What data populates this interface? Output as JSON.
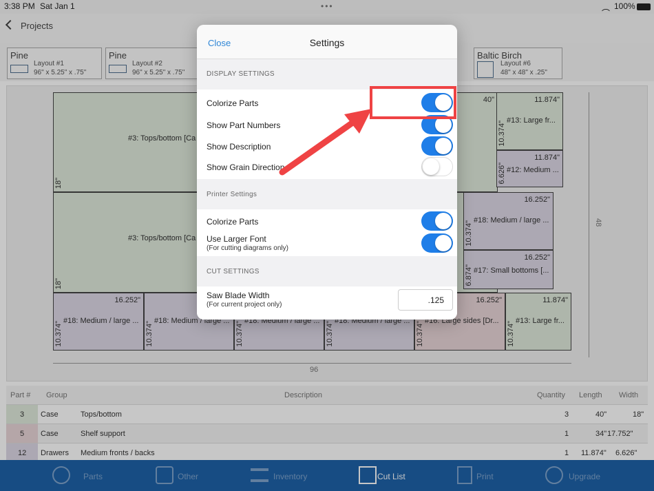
{
  "status": {
    "time": "3:38 PM",
    "date": "Sat Jan 1",
    "battery": "100%"
  },
  "nav": {
    "back_label": "Projects"
  },
  "chips": [
    {
      "material": "Pine",
      "name": "Layout #1",
      "dims": "96\" x 5.25\" x .75\""
    },
    {
      "material": "Pine",
      "name": "Layout #2",
      "dims": "96\" x 5.25\" x .75\""
    },
    {
      "material": "Baltic Birch",
      "name": "Layout #6",
      "dims": "48\" x 48\" x .25\""
    }
  ],
  "diagram": {
    "width_label": "96",
    "height_label": "48",
    "parts": [
      {
        "desc": "#3: Tops/bottom [Ca",
        "len": "",
        "wid": "18\""
      },
      {
        "desc": "#3: Tops/bottom [Ca",
        "len": "",
        "wid": "18\""
      },
      {
        "desc": "",
        "len": "40\"",
        "wid": ""
      },
      {
        "desc": "#13: Large fr...",
        "len": "11.874\"",
        "wid": "10.374\""
      },
      {
        "desc": "#12: Medium ...",
        "len": "11.874\"",
        "wid": "6.626\""
      },
      {
        "desc": "#18: Medium / large ...",
        "len": "16.252\"",
        "wid": "10.374\""
      },
      {
        "desc": "#17: Small bottoms [...",
        "len": "16.252\"",
        "wid": "6.874\""
      },
      {
        "desc": "#18: Medium / large ...",
        "len": "16.252\"",
        "wid": "10.374\""
      },
      {
        "desc": "#18: Medium / large ...",
        "len": "",
        "wid": "10.374\""
      },
      {
        "desc": "#18: Medium / large ...",
        "len": "",
        "wid": "10.374\""
      },
      {
        "desc": "#18: Medium / large ...",
        "len": "",
        "wid": "10.374\""
      },
      {
        "desc": "#16: Large sides [Dr...",
        "len": "16.252\"",
        "wid": "10.374\""
      },
      {
        "desc": "#13: Large fr...",
        "len": "11.874\"",
        "wid": "10.374\""
      }
    ]
  },
  "table": {
    "headers": [
      "Part #",
      "Group",
      "Description",
      "Quantity",
      "Length",
      "Width"
    ],
    "rows": [
      {
        "part": "3",
        "group": "Case",
        "desc": "Tops/bottom",
        "qty": "3",
        "len": "40\"",
        "wid": "18\"",
        "color": "#dfe9dc"
      },
      {
        "part": "5",
        "group": "Case",
        "desc": "Shelf support",
        "qty": "1",
        "len": "34\"",
        "wid": "17.752\"",
        "color": "#e8d5d8"
      },
      {
        "part": "12",
        "group": "Drawers",
        "desc": "Medium fronts / backs",
        "qty": "1",
        "len": "11.874\"",
        "wid": "6.626\"",
        "color": "#ddd8e6"
      }
    ]
  },
  "tabs": [
    {
      "label": "Parts",
      "icon": "tape-measure-icon"
    },
    {
      "label": "Other",
      "icon": "other-tools-icon"
    },
    {
      "label": "Inventory",
      "icon": "stack-icon"
    },
    {
      "label": "Cut List",
      "icon": "cut-list-icon",
      "active": true
    },
    {
      "label": "Print",
      "icon": "print-icon"
    },
    {
      "label": "Upgrade",
      "icon": "upgrade-arrow-icon"
    }
  ],
  "modal": {
    "close_label": "Close",
    "title": "Settings",
    "display_header": "DISPLAY SETTINGS",
    "display": [
      {
        "label": "Colorize Parts",
        "on": true
      },
      {
        "label": "Show Part Numbers",
        "on": true
      },
      {
        "label": "Show Description",
        "on": true
      },
      {
        "label": "Show Grain Direction",
        "on": false
      }
    ],
    "printer_header": "Printer Settings",
    "printer": [
      {
        "label": "Colorize Parts",
        "sub": "",
        "on": true
      },
      {
        "label": "Use Larger Font",
        "sub": "(For cutting diagrams only)",
        "on": true
      }
    ],
    "cut_header": "CUT SETTINGS",
    "blade_label": "Saw Blade Width",
    "blade_sub": "(For current project only)",
    "blade_value": ".125"
  },
  "colors": {
    "accent": "#1f7ee8",
    "tabbar": "#1e62a8",
    "annotation": "#ef4344"
  }
}
